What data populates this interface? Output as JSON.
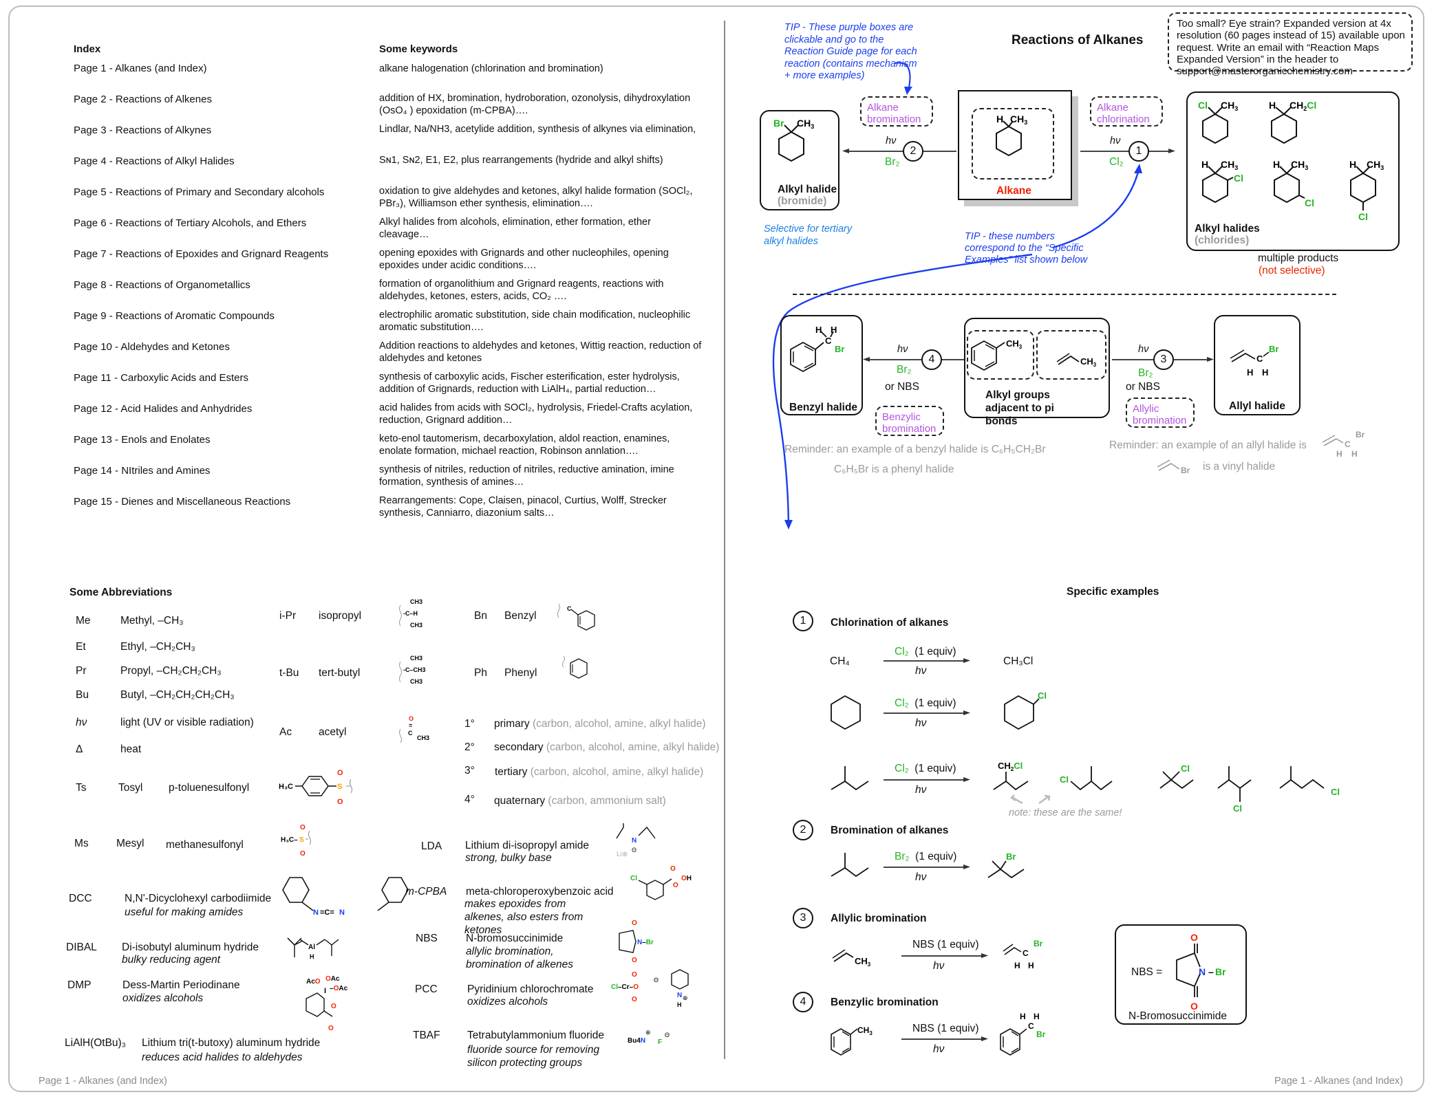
{
  "footer": {
    "left": "Page 1 - Alkanes (and Index)",
    "right": "Page 1 - Alkanes (and Index)"
  },
  "index": {
    "heading": "Index",
    "keywords_heading": "Some keywords",
    "rows": [
      {
        "page": "Page 1 - Alkanes (and Index)",
        "keywords": "alkane halogenation (chlorination and bromination)"
      },
      {
        "page": "Page 2 - Reactions of Alkenes",
        "keywords": "addition of HX, bromination, hydroboration, ozonolysis, dihydroxylation (OsO₄ ) epoxidation (m-CPBA)…."
      },
      {
        "page": "Page 3 - Reactions of Alkynes",
        "keywords": "Lindlar, Na/NH3, acetylide addition, synthesis of alkynes via elimination,"
      },
      {
        "page": "Page 4 - Reactions of Alkyl Halides",
        "keywords": "Sɴ1, Sɴ2, E1, E2, plus rearrangements (hydride and alkyl shifts)"
      },
      {
        "page": "Page 5 - Reactions of Primary and Secondary alcohols",
        "keywords": "oxidation to give aldehydes and ketones, alkyl halide formation (SOCl₂, PBr₃), Williamson ether synthesis, elimination…."
      },
      {
        "page": "Page 6 - Reactions of Tertiary Alcohols, and Ethers",
        "keywords": "Alkyl halides from alcohols, elimination, ether formation, ether cleavage…"
      },
      {
        "page": "Page 7 - Reactions of Epoxides and Grignard Reagents",
        "keywords": "opening epoxides with Grignards and other nucleophiles, opening epoxides under acidic conditions…."
      },
      {
        "page": "Page 8 - Reactions of Organometallics",
        "keywords": "formation of organolithium and Grignard reagents, reactions with aldehydes, ketones, esters, acids, CO₂ …."
      },
      {
        "page": "Page 9 - Reactions of Aromatic Compounds",
        "keywords": "electrophilic aromatic substitution, side chain modification, nucleophilic aromatic substitution…."
      },
      {
        "page": "Page 10 - Aldehydes and Ketones",
        "keywords": "Addition reactions to aldehydes and ketones, Wittig reaction, reduction of aldehydes and ketones"
      },
      {
        "page": "Page 11 - Carboxylic Acids and Esters",
        "keywords": "synthesis of carboxylic acids, Fischer esterification, ester hydrolysis, addition of Grignards, reduction with LiAlH₄, partial reduction…"
      },
      {
        "page": "Page 12 - Acid Halides and Anhydrides",
        "keywords": "acid halides from acids with SOCl₂, hydrolysis, Friedel-Crafts acylation, reduction, Grignard addition…"
      },
      {
        "page": "Page 13 - Enols and Enolates",
        "keywords": "keto-enol tautomerism, decarboxylation, aldol reaction, enamines, enolate formation, michael reaction, Robinson annlation…."
      },
      {
        "page": "Page 14 - NItriles and Amines",
        "keywords": "synthesis of nitriles, reduction of nitriles, reductive amination, imine formation, synthesis of amines…"
      },
      {
        "page": "Page 15 - Dienes and Miscellaneous Reactions",
        "keywords": "Rearrangements: Cope, Claisen, pinacol, Curtius, Wolff, Strecker synthesis, Canniarro, diazonium salts…"
      }
    ]
  },
  "abbreviations": {
    "heading": "Some Abbreviations",
    "simple": [
      {
        "abbr": "Me",
        "meaning": "Methyl, –CH₃"
      },
      {
        "abbr": "Et",
        "meaning": "Ethyl, –CH₂CH₃"
      },
      {
        "abbr": "Pr",
        "meaning": "Propyl, –CH₂CH₂CH₃"
      },
      {
        "abbr": "Bu",
        "meaning": "Butyl, –CH₂CH₂CH₂CH₃"
      },
      {
        "abbr": "hν",
        "meaning": "light (UV or visible radiation)"
      },
      {
        "abbr": "Δ",
        "meaning": "heat"
      }
    ],
    "ts": {
      "abbr": "Ts",
      "name": "Tosyl",
      "full": "p-toluenesulfonyl"
    },
    "ms": {
      "abbr": "Ms",
      "name": "Mesyl",
      "full": "methanesulfonyl"
    },
    "ipr": {
      "abbr": "i-Pr",
      "name": "isopropyl"
    },
    "tbu": {
      "abbr": "t-Bu",
      "name": "tert-butyl"
    },
    "ac": {
      "abbr": "Ac",
      "name": "acetyl"
    },
    "bn": {
      "abbr": "Bn",
      "name": "Benzyl"
    },
    "ph": {
      "abbr": "Ph",
      "name": "Phenyl"
    },
    "degrees": [
      {
        "deg": "1°",
        "term": "primary",
        "note": "(carbon, alcohol, amine, alkyl halide)"
      },
      {
        "deg": "2°",
        "term": "secondary",
        "note": "(carbon, alcohol, amine, alkyl halide)"
      },
      {
        "deg": "3°",
        "term": "tertiary",
        "note": "(carbon, alcohol, amine, alkyl halide)"
      },
      {
        "deg": "4°",
        "term": "quaternary",
        "note": "(carbon, ammonium salt)"
      }
    ],
    "reagents_left": [
      {
        "abbr": "DCC",
        "name": "N,N'-Dicyclohexyl carbodiimide",
        "note": "useful for making amides"
      },
      {
        "abbr": "DIBAL",
        "name": "Di-isobutyl aluminum hydride",
        "note": "bulky reducing agent"
      },
      {
        "abbr": "DMP",
        "name": "Dess-Martin Periodinane",
        "note": "oxidizes alcohols"
      },
      {
        "abbr": "LiAlH(OtBu)₃",
        "name": "Lithium tri(t-butoxy) aluminum hydride",
        "note": "reduces acid halides to aldehydes"
      }
    ],
    "reagents_right": [
      {
        "abbr": "LDA",
        "name": "Lithium di-isopropyl amide",
        "note": "strong, bulky base"
      },
      {
        "abbr": "m-CPBA",
        "name": "meta-chloroperoxybenzoic acid",
        "note": "makes epoxides from alkenes, also esters from ketones"
      },
      {
        "abbr": "NBS",
        "name": "N-bromosuccinimide",
        "note": "allylic bromination, bromination of alkenes"
      },
      {
        "abbr": "PCC",
        "name": "Pyridinium chlorochromate",
        "note": "oxidizes alcohols"
      },
      {
        "abbr": "TBAF",
        "name": "Tetrabutylammonium fluoride",
        "note": "fluoride source for removing silicon protecting groups"
      }
    ]
  },
  "map": {
    "title": "Reactions of Alkanes",
    "tip_purple": "TIP - These purple boxes are clickable and go to the Reaction Guide page for each reaction (contains mechanism + more examples)",
    "tip_numbers": "TIP - these numbers correspond to the “Specific Examples” list shown below",
    "expanded_note": "Too small? Eye strain? Expanded version at 4x resolution (60 pages instead of 15) available upon request. Write an email with “Reaction Maps Expanded Version” in the header to support@masterorganicchemistry.com",
    "alkane_label": "Alkane",
    "alkyl_halide_bromide": {
      "title": "Alkyl halide",
      "sub": "(bromide)"
    },
    "selective_note": "Selective for tertiary alkyl halides",
    "alkyl_halides_chlorides": {
      "title": "Alkyl halides",
      "sub": "(chlorides)"
    },
    "multiple_products": "multiple products",
    "not_selective": "(not selective)",
    "purple_boxes": {
      "bromination": "Alkane bromination",
      "chlorination": "Alkane chlorination",
      "benzylic": "Benzylic bromination",
      "allylic": "Allylic bromination"
    },
    "reactions": [
      {
        "num": "1",
        "top": "hν",
        "bottom": "Cl₂"
      },
      {
        "num": "2",
        "top": "hν",
        "bottom": "Br₂"
      },
      {
        "num": "3",
        "top": "hν",
        "bottom": "Br₂",
        "extra": "or NBS"
      },
      {
        "num": "4",
        "top": "hν",
        "bottom": "Br₂",
        "extra": "or NBS"
      }
    ],
    "benzyl_halide": "Benzyl halide",
    "allyl_halide": "Allyl halide",
    "adjacent_pi": "Alkyl groups adjacent to pi bonds",
    "reminder_benzyl": "Reminder: an example of a benzyl halide is C₆H₅CH₂Br",
    "reminder_phenyl": "C₆H₅Br is a phenyl halide",
    "reminder_allyl": "Reminder: an example of an allyl halide is",
    "reminder_vinyl": "is a vinyl halide"
  },
  "examples": {
    "heading": "Specific examples",
    "sections": [
      {
        "num": "1",
        "title": "Chlorination of alkanes"
      },
      {
        "num": "2",
        "title": "Bromination of alkanes"
      },
      {
        "num": "3",
        "title": "Allylic bromination"
      },
      {
        "num": "4",
        "title": "Benzylic bromination"
      }
    ],
    "conditions": {
      "cl2": "Cl₂",
      "br2": "Br₂",
      "equiv": "(1 equiv)",
      "nbs": "NBS",
      "hv": "hν"
    },
    "ch4": "CH₄",
    "ch3cl": "CH₃Cl",
    "same_note": "note: these are the same!",
    "nbs_box": {
      "label": "NBS =",
      "name": "N-Bromosuccinimide"
    }
  }
}
